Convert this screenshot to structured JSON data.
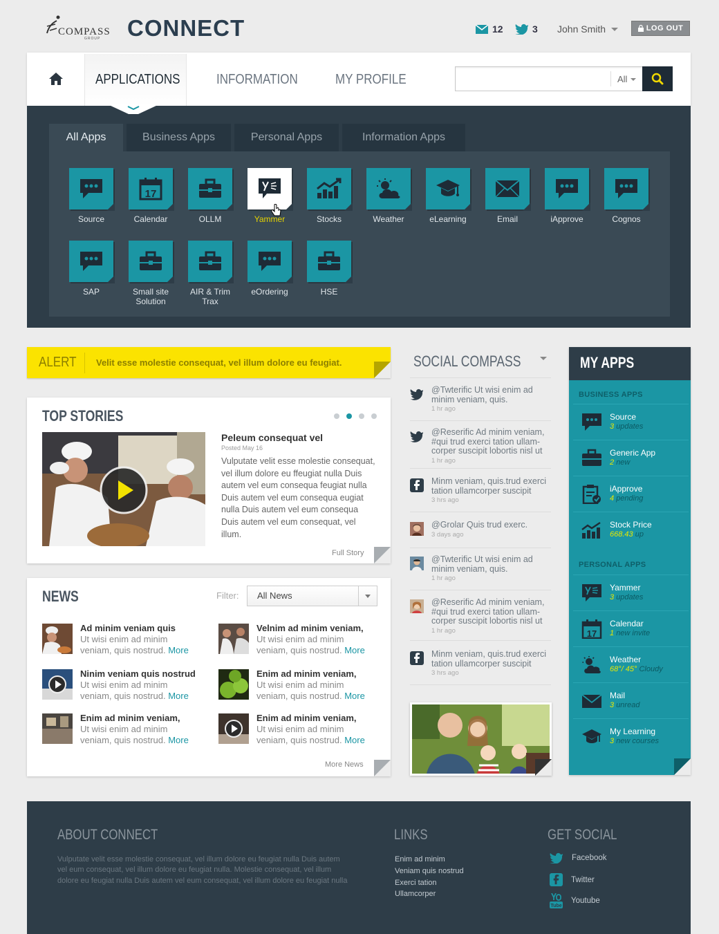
{
  "header": {
    "logo_primary": "COMPASS",
    "logo_sub": "GROUP",
    "app_name": "CONNECT",
    "mail_count": "12",
    "twitter_count": "3",
    "user_name": "John Smith",
    "logout_label": "LOG OUT"
  },
  "nav": {
    "tabs": [
      "APPLICATIONS",
      "INFORMATION",
      "MY PROFILE"
    ],
    "active": "APPLICATIONS",
    "search_scope": "All"
  },
  "apps_panel": {
    "tabs": [
      "All Apps",
      "Business Apps",
      "Personal Apps",
      "Information Apps"
    ],
    "active_tab": "All Apps",
    "apps": [
      {
        "label": "Source",
        "icon": "chat-bubble-icon"
      },
      {
        "label": "Calendar",
        "icon": "calendar-icon"
      },
      {
        "label": "OLLM",
        "icon": "briefcase-icon"
      },
      {
        "label": "Yammer",
        "icon": "yammer-icon",
        "highlighted": true
      },
      {
        "label": "Stocks",
        "icon": "bar-chart-icon"
      },
      {
        "label": "Weather",
        "icon": "weather-icon"
      },
      {
        "label": "eLearning",
        "icon": "graduation-cap-icon"
      },
      {
        "label": "Email",
        "icon": "envelope-icon"
      },
      {
        "label": "iApprove",
        "icon": "chat-bubble-icon"
      },
      {
        "label": "Cognos",
        "icon": "chat-bubble-icon"
      },
      {
        "label": "SAP",
        "icon": "chat-bubble-icon"
      },
      {
        "label": "Small site Solution",
        "icon": "briefcase-icon"
      },
      {
        "label": "AIR & Trim Trax",
        "icon": "briefcase-icon"
      },
      {
        "label": "eOrdering",
        "icon": "chat-bubble-icon"
      },
      {
        "label": "HSE",
        "icon": "briefcase-icon"
      }
    ]
  },
  "alert": {
    "label": "ALERT",
    "text": "Velit esse molestie consequat, vel illum dolore eu feugiat."
  },
  "top_stories": {
    "title": "TOP STORIES",
    "headline": "Peleum consequat vel",
    "date": "Posted May 16",
    "body": "Vulputate velit esse molestie consequat, vel illum dolore eu ffeugiat nulla Duis autem vel eum consequa feugiat nulla Duis autem vel eum consequa eugiat nulla Duis autem vel eum consequa Duis autem vel eum consequat, vel illum.",
    "full_story": "Full Story",
    "slide_count": 4,
    "active_slide": 2
  },
  "news": {
    "title": "NEWS",
    "filter_label": "Filter:",
    "filter_value": "All News",
    "more_label": "More",
    "more_news": "More News",
    "items": [
      {
        "title": "Ad minim veniam quis",
        "desc": "Ut wisi enim ad minim veniam, quis nostrud."
      },
      {
        "title": "Velnim ad minim veniam,",
        "desc": "Ut wisi enim ad minim veniam, quis nostrud."
      },
      {
        "title": "Ninim veniam quis nostrud",
        "desc": "Ut wisi enim ad minim veniam, quis nostrud."
      },
      {
        "title": "Enim ad minim veniam,",
        "desc": "Ut wisi enim ad minim veniam, quis nostrud."
      },
      {
        "title": "Enim ad minim veniam,",
        "desc": "Ut wisi enim ad minim veniam, quis nostrud."
      },
      {
        "title": "Enim ad minim veniam,",
        "desc": "Ut wisi enim ad minim veniam, quis nostrud."
      }
    ]
  },
  "social": {
    "title": "SOCIAL COMPASS",
    "items": [
      {
        "icon": "twitter-icon",
        "text": "@Twterific Ut wisi enim ad minim veniam, quis.",
        "ago": "1 hr ago"
      },
      {
        "icon": "twitter-icon",
        "text": "@Reserific Ad minim veniam, #qui trud exerci tation ullam-corper suscipit lobortis nisl ut",
        "ago": "1 hr ago"
      },
      {
        "icon": "facebook-icon",
        "text": "Minm veniam, quis.trud exerci tation ullamcorper suscipit",
        "ago": "3 hrs ago"
      },
      {
        "icon": "avatar-icon",
        "text": "@Grolar Quis trud exerc.",
        "ago": "3 days ago"
      },
      {
        "icon": "avatar-icon",
        "text": "@Twterific Ut wisi enim ad minim veniam, quis.",
        "ago": "1 hr ago"
      },
      {
        "icon": "avatar-icon",
        "text": "@Reserific Ad minim veniam, #qui trud exerci tation ullam-corper suscipit lobortis nisl ut",
        "ago": "1 hr ago"
      },
      {
        "icon": "facebook-icon",
        "text": "Minm veniam, quis.trud exerci tation ullamcorper suscipit",
        "ago": "3 hrs ago"
      }
    ]
  },
  "my_apps": {
    "title": "MY APPS",
    "business_label": "BUSINESS APPS",
    "personal_label": "PERSONAL APPS",
    "business": [
      {
        "name": "Source",
        "count": "3",
        "status": "updates",
        "icon": "chat-bubble-icon"
      },
      {
        "name": "Generic App",
        "count": "2",
        "status": "new",
        "icon": "briefcase-icon"
      },
      {
        "name": "iApprove",
        "count": "4",
        "status": "pending",
        "icon": "clipboard-check-icon"
      },
      {
        "name": "Stock Price",
        "count": "668.43",
        "status": "up",
        "icon": "bar-chart-icon"
      }
    ],
    "personal": [
      {
        "name": "Yammer",
        "count": "3",
        "status": "updates",
        "icon": "yammer-icon"
      },
      {
        "name": "Calendar",
        "count": "1",
        "status": "new invite",
        "icon": "calendar-icon"
      },
      {
        "name": "Weather",
        "count": "68°/ 45°",
        "status": "Cloudy",
        "icon": "weather-icon"
      },
      {
        "name": "Mail",
        "count": "3",
        "status": "unread",
        "icon": "envelope-icon"
      },
      {
        "name": "My Learning",
        "count": "3",
        "status": "new courses",
        "icon": "graduation-cap-icon"
      }
    ]
  },
  "footer": {
    "about_title": "ABOUT CONNECT",
    "about_text": "Vulputate velit esse molestie consequat, vel illum dolore eu feugiat nulla Duis autem vel eum consequat, vel illum dolore eu feugiat nulla.  Molestie consequat, vel illum dolore eu feugiat nulla Duis autem vel eum consequat, vel illum dolore eu feugiat nulla",
    "links_title": "LINKS",
    "links": [
      "Enim ad minim",
      "Veniam quis nostrud",
      "Exerci tation",
      "Ullamcorper"
    ],
    "social_title": "GET SOCIAL",
    "social": [
      "Facebook",
      "Twitter",
      "Youtube"
    ]
  },
  "colors": {
    "accent": "#1b96a4",
    "dark": "#2e3d48",
    "alert": "#fbe300",
    "highlight": "#e5d300"
  }
}
